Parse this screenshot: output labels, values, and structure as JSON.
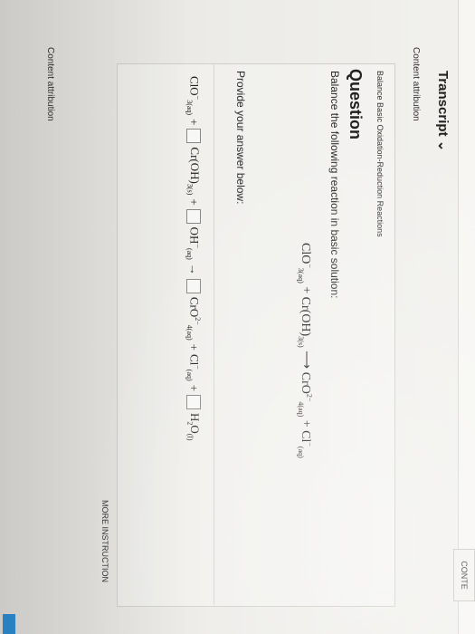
{
  "header": {
    "transcript_label": "Transcript",
    "transcript_chevron": "⌄",
    "content_attribution_top": "Content attribution",
    "contents_button": "CONTE"
  },
  "question": {
    "category": "Balance Basic Oxidation-Reduction Reactions",
    "title": "Question",
    "prompt": "Balance the following reaction in basic solution:",
    "provide_answer": "Provide your answer below:"
  },
  "reaction": {
    "r1": "ClO",
    "r1_sub": "3(aq)",
    "r1_sup": "−",
    "plus1": " + ",
    "r2": "Cr(OH)",
    "r2_sub": "3(s)",
    "arrow": " ⟶ ",
    "p1": "CrO",
    "p1_sub": "4(aq)",
    "p1_sup": "2−",
    "plus2": " + ",
    "p2": "Cl",
    "p2_sub": "(aq)",
    "p2_sup": "−"
  },
  "answer_row": {
    "t1": "ClO",
    "t1_sub": "3(aq)",
    "t1_sup": "−",
    "plus": "+",
    "t2": "Cr(OH)",
    "t2_sub": "3(s)",
    "t3": "OH",
    "t3_sub": "(aq)",
    "t3_sup": "−",
    "arrow": "→",
    "t4": "CrO",
    "t4_sub": "4(aq)",
    "t4_sup": "2−",
    "t5": "Cl",
    "t5_sub": "(aq)",
    "t5_sup": "−",
    "t6": "H",
    "t6_sub1": "2",
    "t6_rest": "O",
    "t6_sub2": "(l)"
  },
  "footer": {
    "more_instruction": "MORE INSTRUCTION",
    "content_attribution_bottom": "Content attribution"
  }
}
